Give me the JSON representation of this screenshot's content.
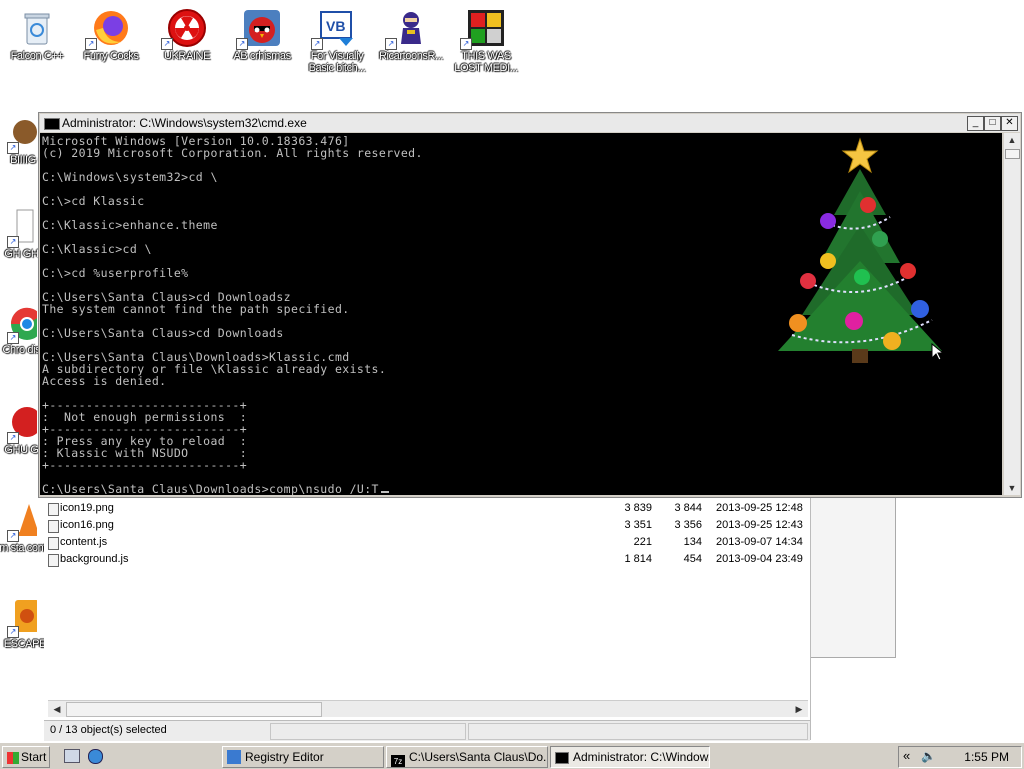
{
  "desktop": {
    "icons": [
      {
        "label": "Falcon C++",
        "icon": "recycle-icon"
      },
      {
        "label": "Furry Cocks",
        "icon": "firefox-icon"
      },
      {
        "label": "UKRAINE",
        "icon": "radiation-icon"
      },
      {
        "label": "AB crhismas",
        "icon": "angry-bird-icon"
      },
      {
        "label": "For Visually Basic bitch...",
        "icon": "vb-icon"
      },
      {
        "label": "RicartoonsR...",
        "icon": "ninja-icon"
      },
      {
        "label": "THIS WAS LOST MEDI...",
        "icon": "media-icon"
      }
    ],
    "left_icons": [
      {
        "label": "BIIIIG C",
        "icon": "game-icon"
      },
      {
        "label": "GH GHC",
        "icon": "document-icon"
      },
      {
        "label": "Chro dise",
        "icon": "chrome-icon"
      },
      {
        "label": "GHU GU",
        "icon": "red-app-icon"
      },
      {
        "label": "cum sta cont",
        "icon": "vlc-icon"
      },
      {
        "label": "ESCAPE",
        "icon": "orange-app-icon"
      }
    ]
  },
  "cmd": {
    "title": "Administrator: C:\\Windows\\system32\\cmd.exe",
    "lines": [
      "Microsoft Windows [Version 10.0.18363.476]",
      "(c) 2019 Microsoft Corporation. All rights reserved.",
      "",
      "C:\\Windows\\system32>cd \\",
      "",
      "C:\\>cd Klassic",
      "",
      "C:\\Klassic>enhance.theme",
      "",
      "C:\\Klassic>cd \\",
      "",
      "C:\\>cd %userprofile%",
      "",
      "C:\\Users\\Santa Claus>cd Downloadsz",
      "The system cannot find the path specified.",
      "",
      "C:\\Users\\Santa Claus>cd Downloads",
      "",
      "C:\\Users\\Santa Claus\\Downloads>Klassic.cmd",
      "A subdirectory or file \\Klassic already exists.",
      "Access is denied.",
      "",
      "+--------------------------+",
      ":  Not enough permissions  :",
      "+--------------------------+",
      ": Press any key to reload  :",
      ": Klassic with NSUDO       :",
      "+--------------------------+",
      "",
      "C:\\Users\\Santa Claus\\Downloads>comp\\nsudo /U:T"
    ],
    "buttons": {
      "minimize": "_",
      "maximize": "□",
      "close": "✕"
    }
  },
  "explorer": {
    "files": [
      {
        "name": "icon19.png",
        "size1": "3 839",
        "size2": "3 844",
        "date": "2013-09-25 12:48"
      },
      {
        "name": "icon16.png",
        "size1": "3 351",
        "size2": "3 356",
        "date": "2013-09-25 12:43"
      },
      {
        "name": "content.js",
        "size1": "221",
        "size2": "134",
        "date": "2013-09-07 14:34"
      },
      {
        "name": "background.js",
        "size1": "1 814",
        "size2": "454",
        "date": "2013-09-04 23:49"
      }
    ],
    "status": "0 / 13 object(s) selected"
  },
  "taskbar": {
    "start": "Start",
    "tasks": [
      {
        "label": "Registry Editor",
        "icon": "registry-icon",
        "active": false
      },
      {
        "label": "C:\\Users\\Santa Claus\\Do...",
        "icon": "7zip-icon",
        "active": false
      },
      {
        "label": "Administrator: C:\\Window...",
        "icon": "cmd-icon",
        "active": true
      }
    ],
    "clock": "1:55 PM"
  }
}
